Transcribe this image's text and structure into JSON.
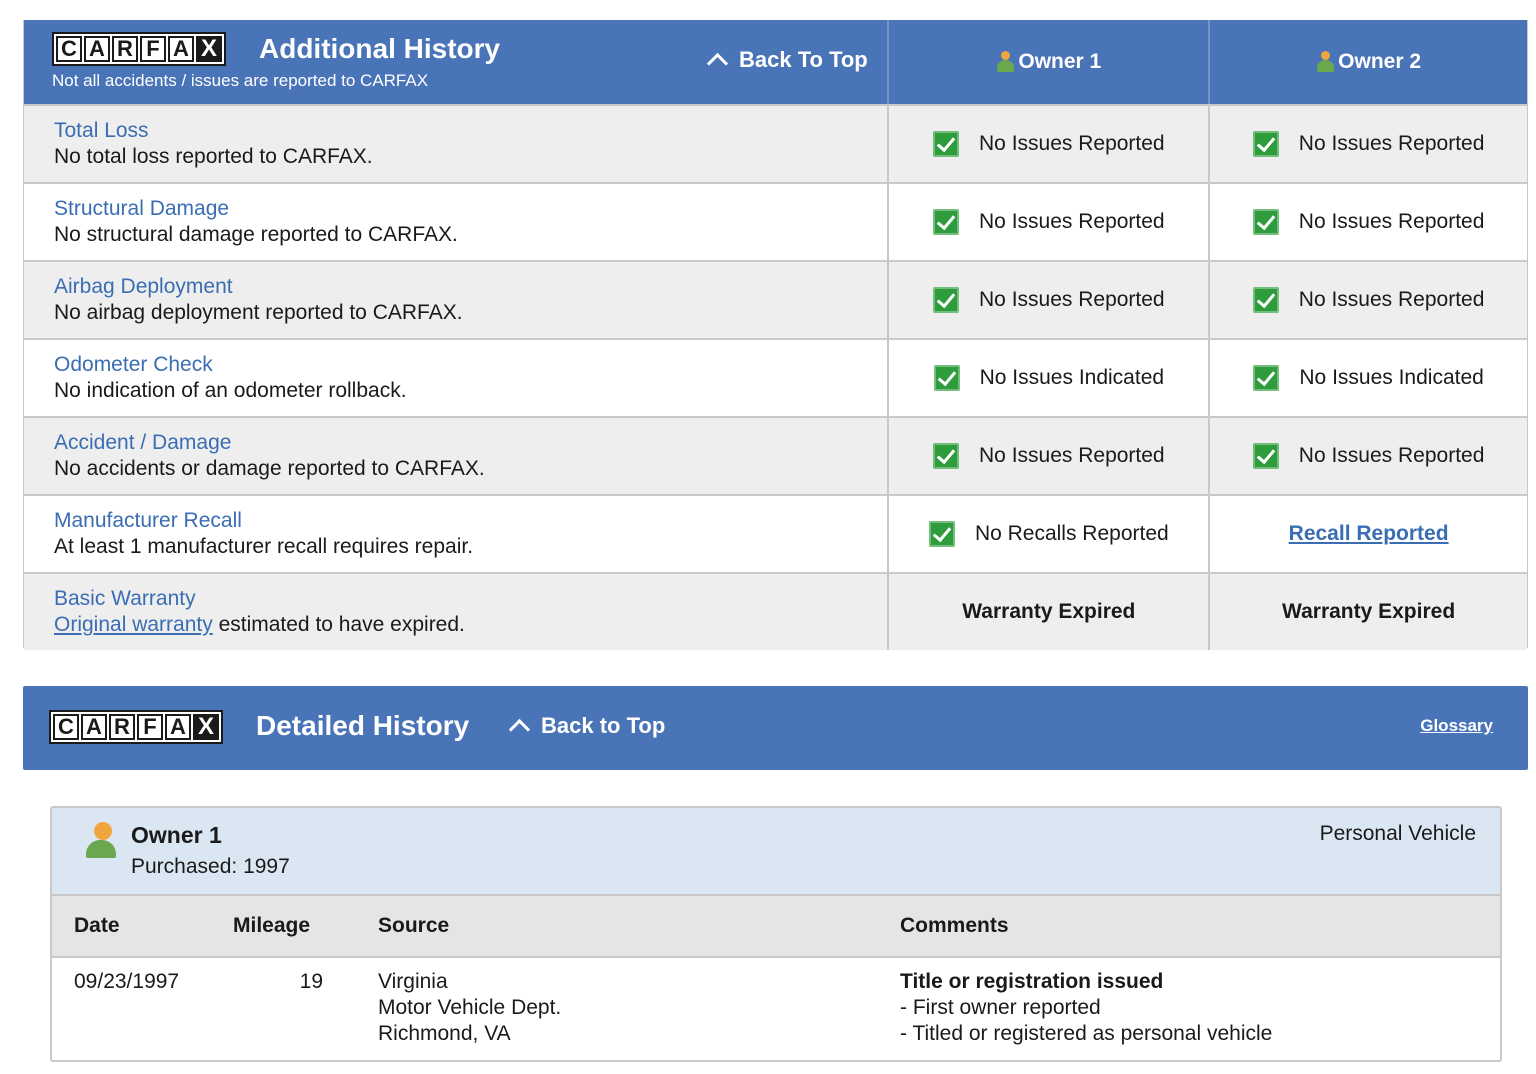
{
  "additional_history": {
    "logo_text": [
      "C",
      "A",
      "R",
      "F",
      "A",
      "X"
    ],
    "title": "Additional History",
    "subtitle": "Not all accidents / issues are reported to CARFAX",
    "back_to_top": "Back To Top",
    "owners": [
      "Owner 1",
      "Owner 2"
    ],
    "rows": [
      {
        "title": "Total Loss",
        "desc": "No total loss reported to CARFAX.",
        "o1": "No Issues Reported",
        "o2": "No Issues Reported"
      },
      {
        "title": "Structural Damage",
        "desc": "No structural damage reported to CARFAX.",
        "o1": "No Issues Reported",
        "o2": "No Issues Reported"
      },
      {
        "title": "Airbag Deployment",
        "desc": "No airbag deployment reported to CARFAX.",
        "o1": "No Issues Reported",
        "o2": "No Issues Reported"
      },
      {
        "title": "Odometer Check",
        "desc": "No indication of an odometer rollback.",
        "o1": "No Issues Indicated",
        "o2": "No Issues Indicated"
      },
      {
        "title": "Accident / Damage",
        "desc": "No accidents or damage reported to CARFAX.",
        "o1": "No Issues Reported",
        "o2": "No Issues Reported"
      },
      {
        "title": "Manufacturer Recall",
        "desc": "At least 1 manufacturer recall requires repair.",
        "o1": "No Recalls Reported",
        "o2": "Recall Reported"
      },
      {
        "title": "Basic Warranty",
        "desc_link": "Original warranty",
        "desc_rest": " estimated to have expired.",
        "o1": "Warranty Expired",
        "o2": "Warranty Expired"
      }
    ]
  },
  "detailed_history": {
    "title": "Detailed History",
    "back_to_top": "Back to Top",
    "glossary": "Glossary",
    "owner": {
      "name": "Owner 1",
      "purchased": "Purchased: 1997",
      "type": "Personal Vehicle"
    },
    "columns": [
      "Date",
      "Mileage",
      "Source",
      "Comments"
    ],
    "record": {
      "date": "09/23/1997",
      "mileage": "19",
      "source": [
        "Virginia",
        "Motor Vehicle Dept.",
        "Richmond, VA"
      ],
      "comment_title": "Title or registration issued",
      "comments": [
        "- First owner reported",
        "- Titled or registered as personal vehicle"
      ]
    }
  },
  "colors": {
    "header_blue": "#4a74b8",
    "link_blue": "#3b6db3",
    "check_green": "#2e9c3d"
  }
}
